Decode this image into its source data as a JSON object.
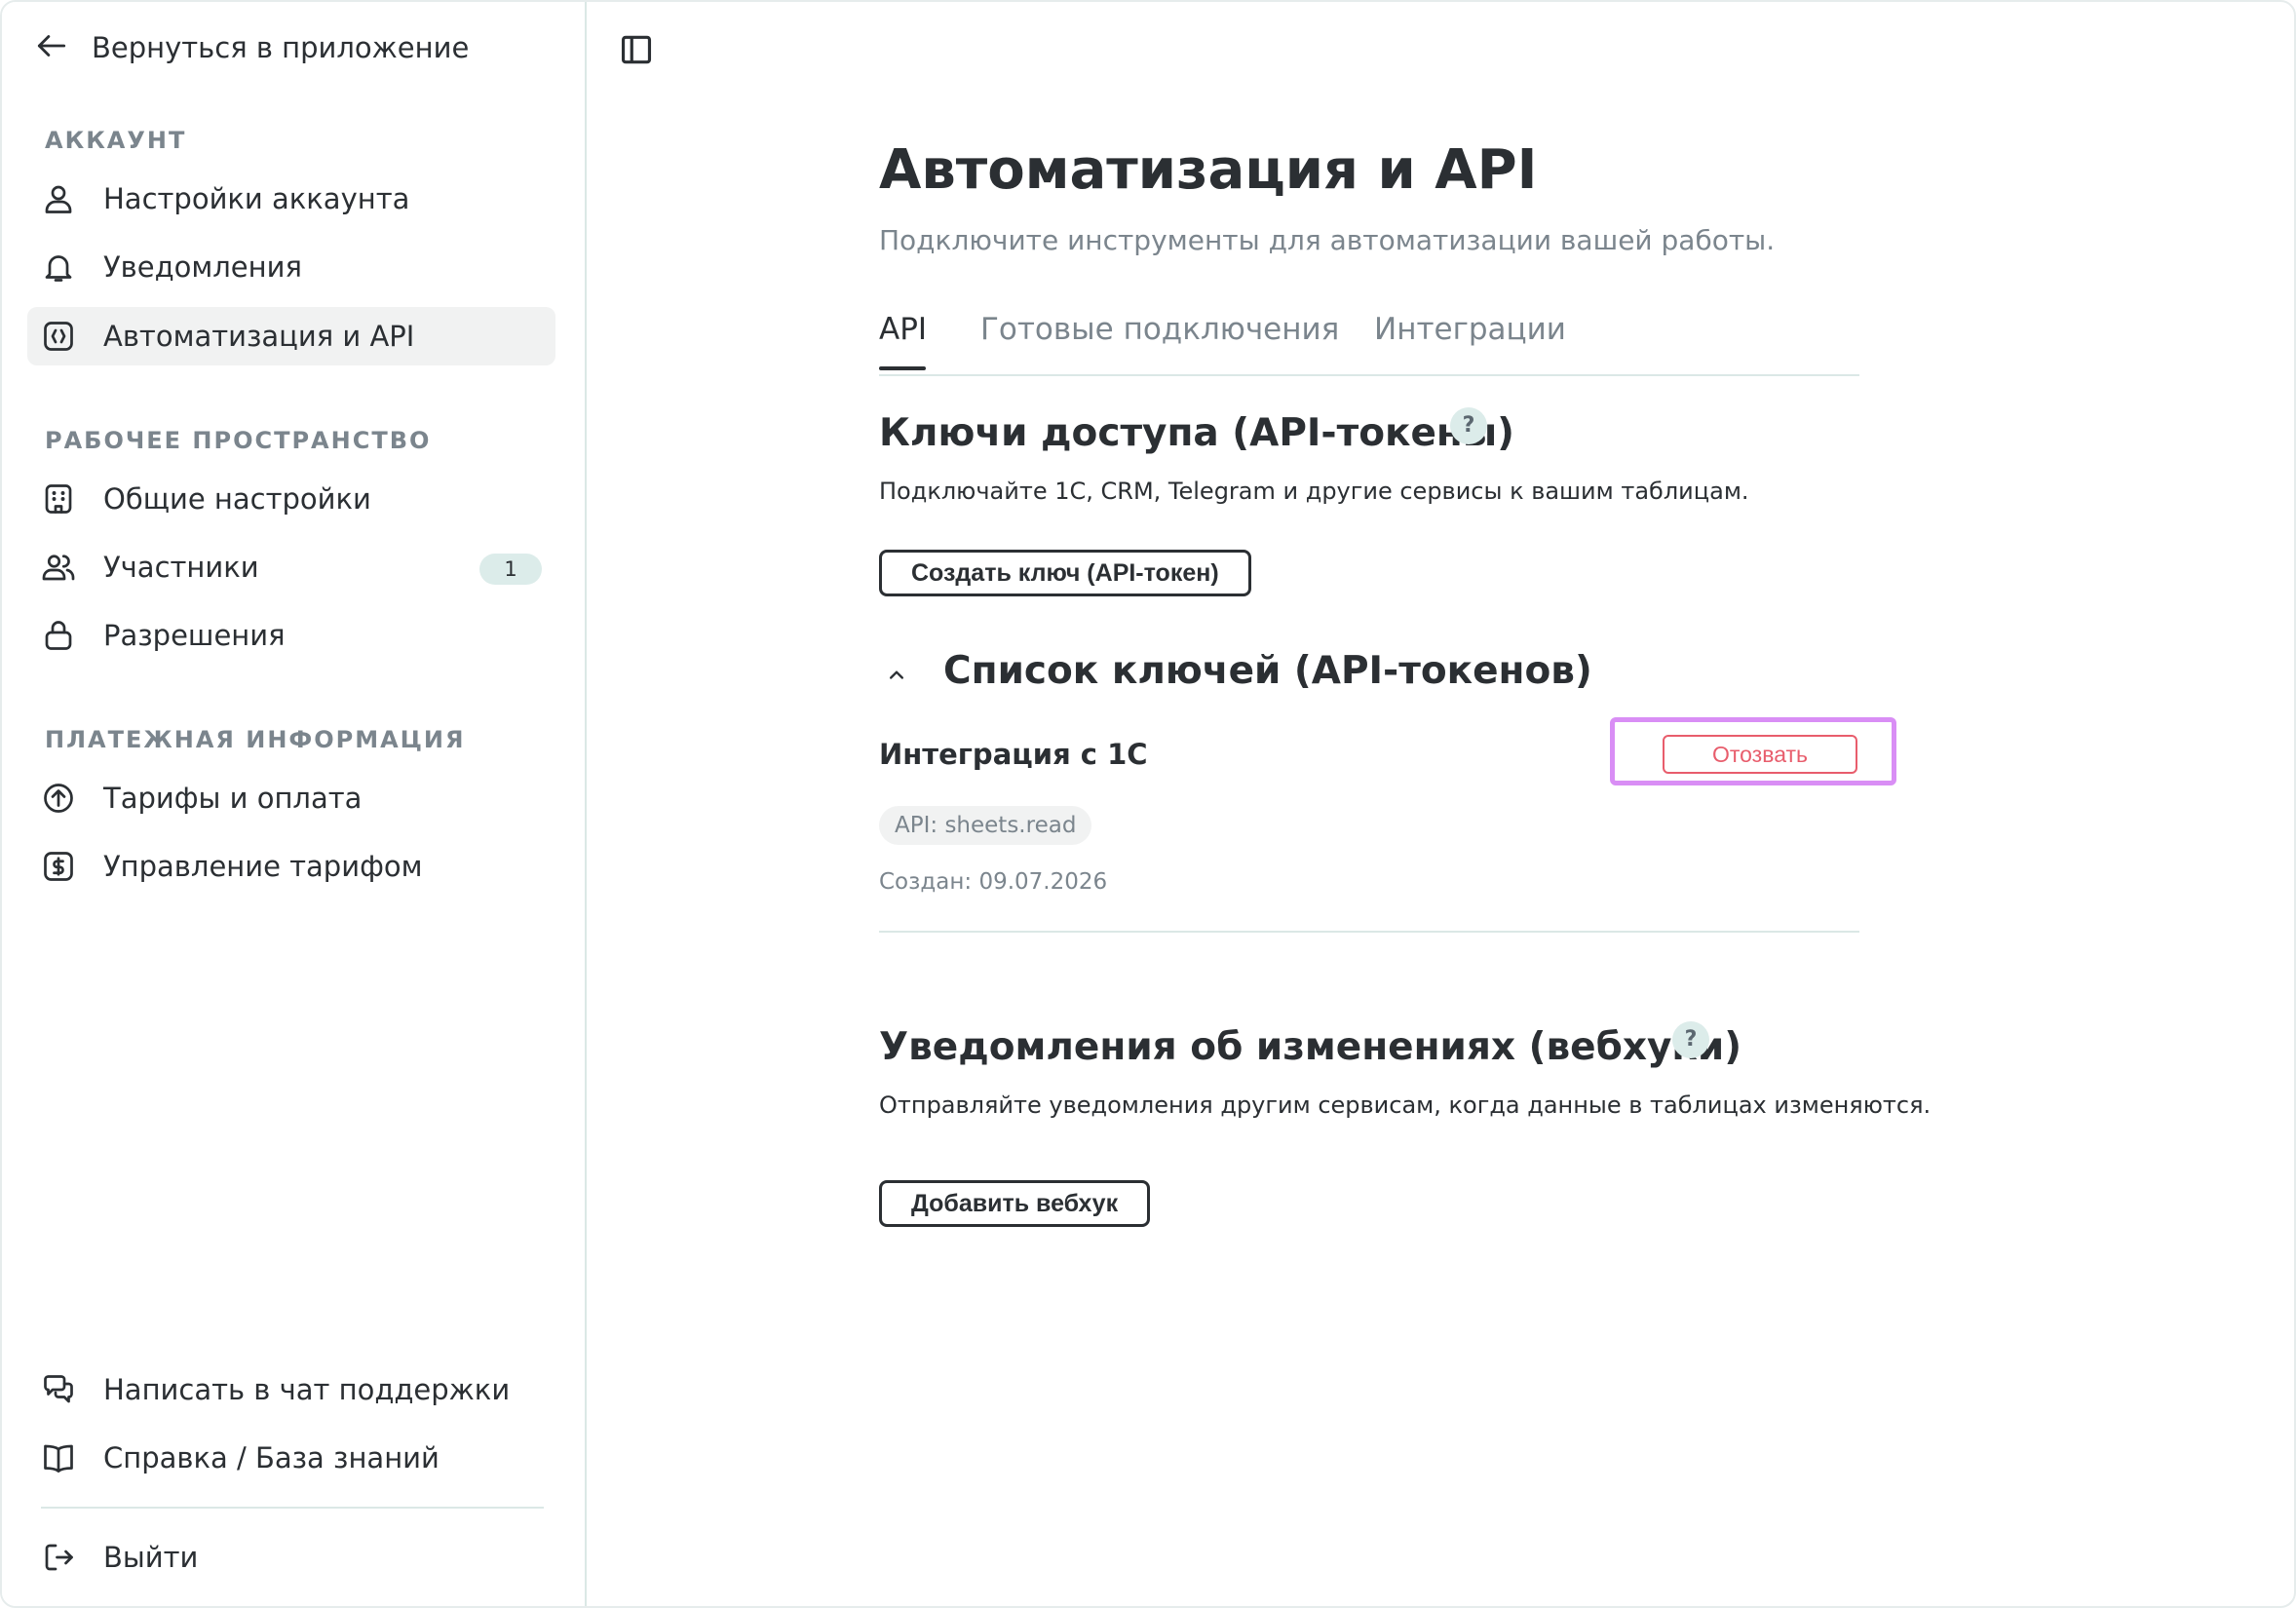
{
  "sidebar": {
    "back_label": "Вернуться в приложение",
    "sections": {
      "account": "АККАУНТ",
      "workspace": "РАБОЧЕЕ ПРОСТРАНСТВО",
      "billing": "ПЛАТЕЖНАЯ ИНФОРМАЦИЯ"
    },
    "items": {
      "account_settings": "Настройки аккаунта",
      "notifications": "Уведомления",
      "automation_api": "Автоматизация и API",
      "general_settings": "Общие настройки",
      "members": "Участники",
      "members_count": "1",
      "permissions": "Разрешения",
      "plans_payment": "Тарифы и оплата",
      "plan_management": "Управление тарифом",
      "support_chat": "Написать в чат поддержки",
      "help_kb": "Справка / База знаний",
      "logout": "Выйти"
    },
    "active_item": "automation_api"
  },
  "main": {
    "title": "Автоматизация и API",
    "subtitle": "Подключите инструменты для автоматизации вашей работы.",
    "tabs": [
      "API",
      "Готовые подключения",
      "Интеграции"
    ],
    "active_tab": "API",
    "api_keys": {
      "heading": "Ключи доступа (API-токены)",
      "help": "?",
      "description": "Подключайте 1С, CRM, Telegram и другие сервисы к вашим таблицам.",
      "create_button": "Создать ключ (API-токен)"
    },
    "keys_list": {
      "heading": "Список ключей (API-токенов)",
      "expanded": true,
      "tokens": [
        {
          "name": "Интеграция с 1С",
          "scope": "API: sheets.read",
          "created": "Создан: 09.07.2026",
          "revoke_label": "Отозвать"
        }
      ]
    },
    "webhooks": {
      "heading": "Уведомления об изменениях (вебхуки)",
      "help": "?",
      "description": "Отправляйте уведомления другим сервисам, когда данные в таблицах изменяются.",
      "add_button": "Добавить вебхук"
    }
  },
  "colors": {
    "text": "#2b2f33",
    "muted": "#7b858d",
    "divider": "#dbe8e6",
    "badge_bg": "#dcecea",
    "danger": "#e85d6c",
    "highlight": "#d98ef5"
  }
}
